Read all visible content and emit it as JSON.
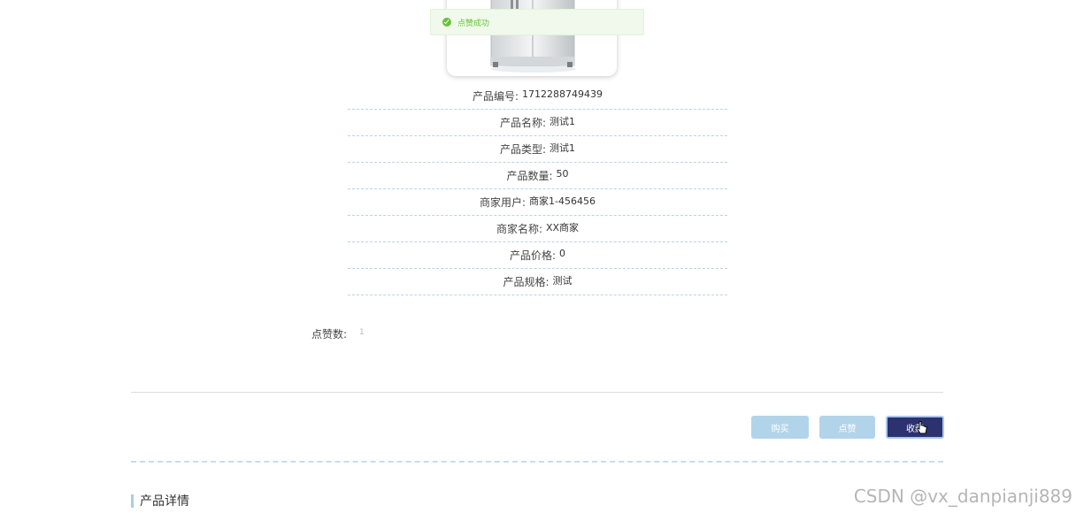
{
  "toast": {
    "message": "点赞成功",
    "icon": "check-circle-icon",
    "color": "#67c23a"
  },
  "product": {
    "image_icon": "refrigerator-image",
    "fields": [
      {
        "label": "产品编号:",
        "value": "1712288749439"
      },
      {
        "label": "产品名称:",
        "value": "测试1"
      },
      {
        "label": "产品类型:",
        "value": "测试1"
      },
      {
        "label": "产品数量:",
        "value": "50"
      },
      {
        "label": "商家用户:",
        "value": "商家1-456456"
      },
      {
        "label": "商家名称:",
        "value": "XX商家"
      },
      {
        "label": "产品价格:",
        "value": "0"
      },
      {
        "label": "产品规格:",
        "value": "测试"
      }
    ]
  },
  "likes": {
    "label": "点赞数:",
    "value": "1"
  },
  "actions": {
    "buy_label": "购买",
    "like_label": "点赞",
    "favorite_label": "收藏",
    "colors": {
      "light": "#b2d4ea",
      "dark": "#2c3170"
    }
  },
  "details": {
    "title": "产品详情"
  },
  "watermark": "CSDN @vx_danpianji889"
}
